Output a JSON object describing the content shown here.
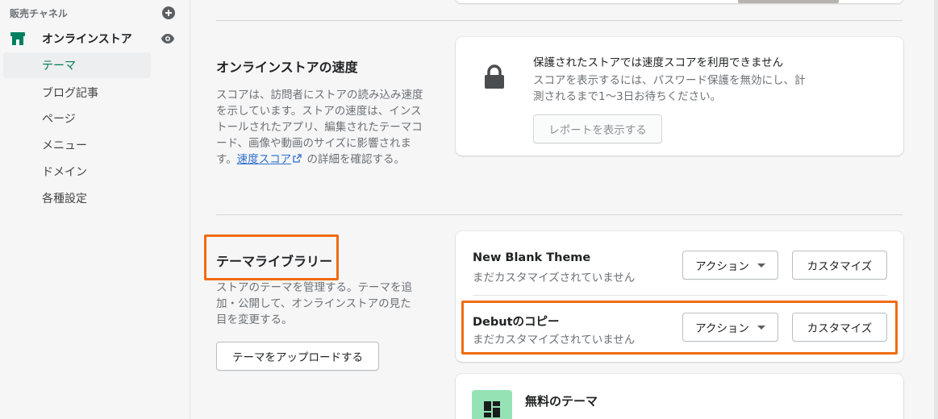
{
  "sidebar": {
    "section_label": "販売チャネル",
    "store_label": "オンラインストア",
    "items": [
      {
        "label": "テーマ",
        "active": true
      },
      {
        "label": "ブログ記事"
      },
      {
        "label": "ページ"
      },
      {
        "label": "メニュー"
      },
      {
        "label": "ドメイン"
      },
      {
        "label": "各種設定"
      }
    ],
    "accent_color": "#007a5c"
  },
  "speed": {
    "title": "オンラインストアの速度",
    "desc_before": "スコアは、訪問者にストアの読み込み速度を示しています。ストアの速度は、インストールされたアプリ、編集されたテーマコード、画像や動画のサイズに影響されます。",
    "desc_link": "速度スコア",
    "desc_after": " の詳細を確認する。",
    "card": {
      "icon": "lock-icon",
      "heading": "保護されたストアでは速度スコアを利用できません",
      "body_line1": "スコアを表示するには、パスワード保護を無効にし、計",
      "body_line2": "測されるまで1〜3日お待ちください。",
      "button": "レポートを表示する"
    }
  },
  "library": {
    "title": "テーマライブラリー",
    "desc_line1": "ストアのテーマを管理する。テーマを追",
    "desc_line2": "加・公開して、オンラインストアの見た",
    "desc_line3": "目を変更する。",
    "upload_button": "テーマをアップロードする",
    "themes": [
      {
        "name": "New Blank Theme",
        "status": "まだカスタマイズされていません",
        "action": "アクション",
        "customize": "カスタマイズ"
      },
      {
        "name": "Debutのコピー",
        "status": "まだカスタマイズされていません",
        "action": "アクション",
        "customize": "カスタマイズ"
      }
    ]
  },
  "free_themes": {
    "title": "無料のテーマ"
  },
  "highlight_color": "#f06b12"
}
